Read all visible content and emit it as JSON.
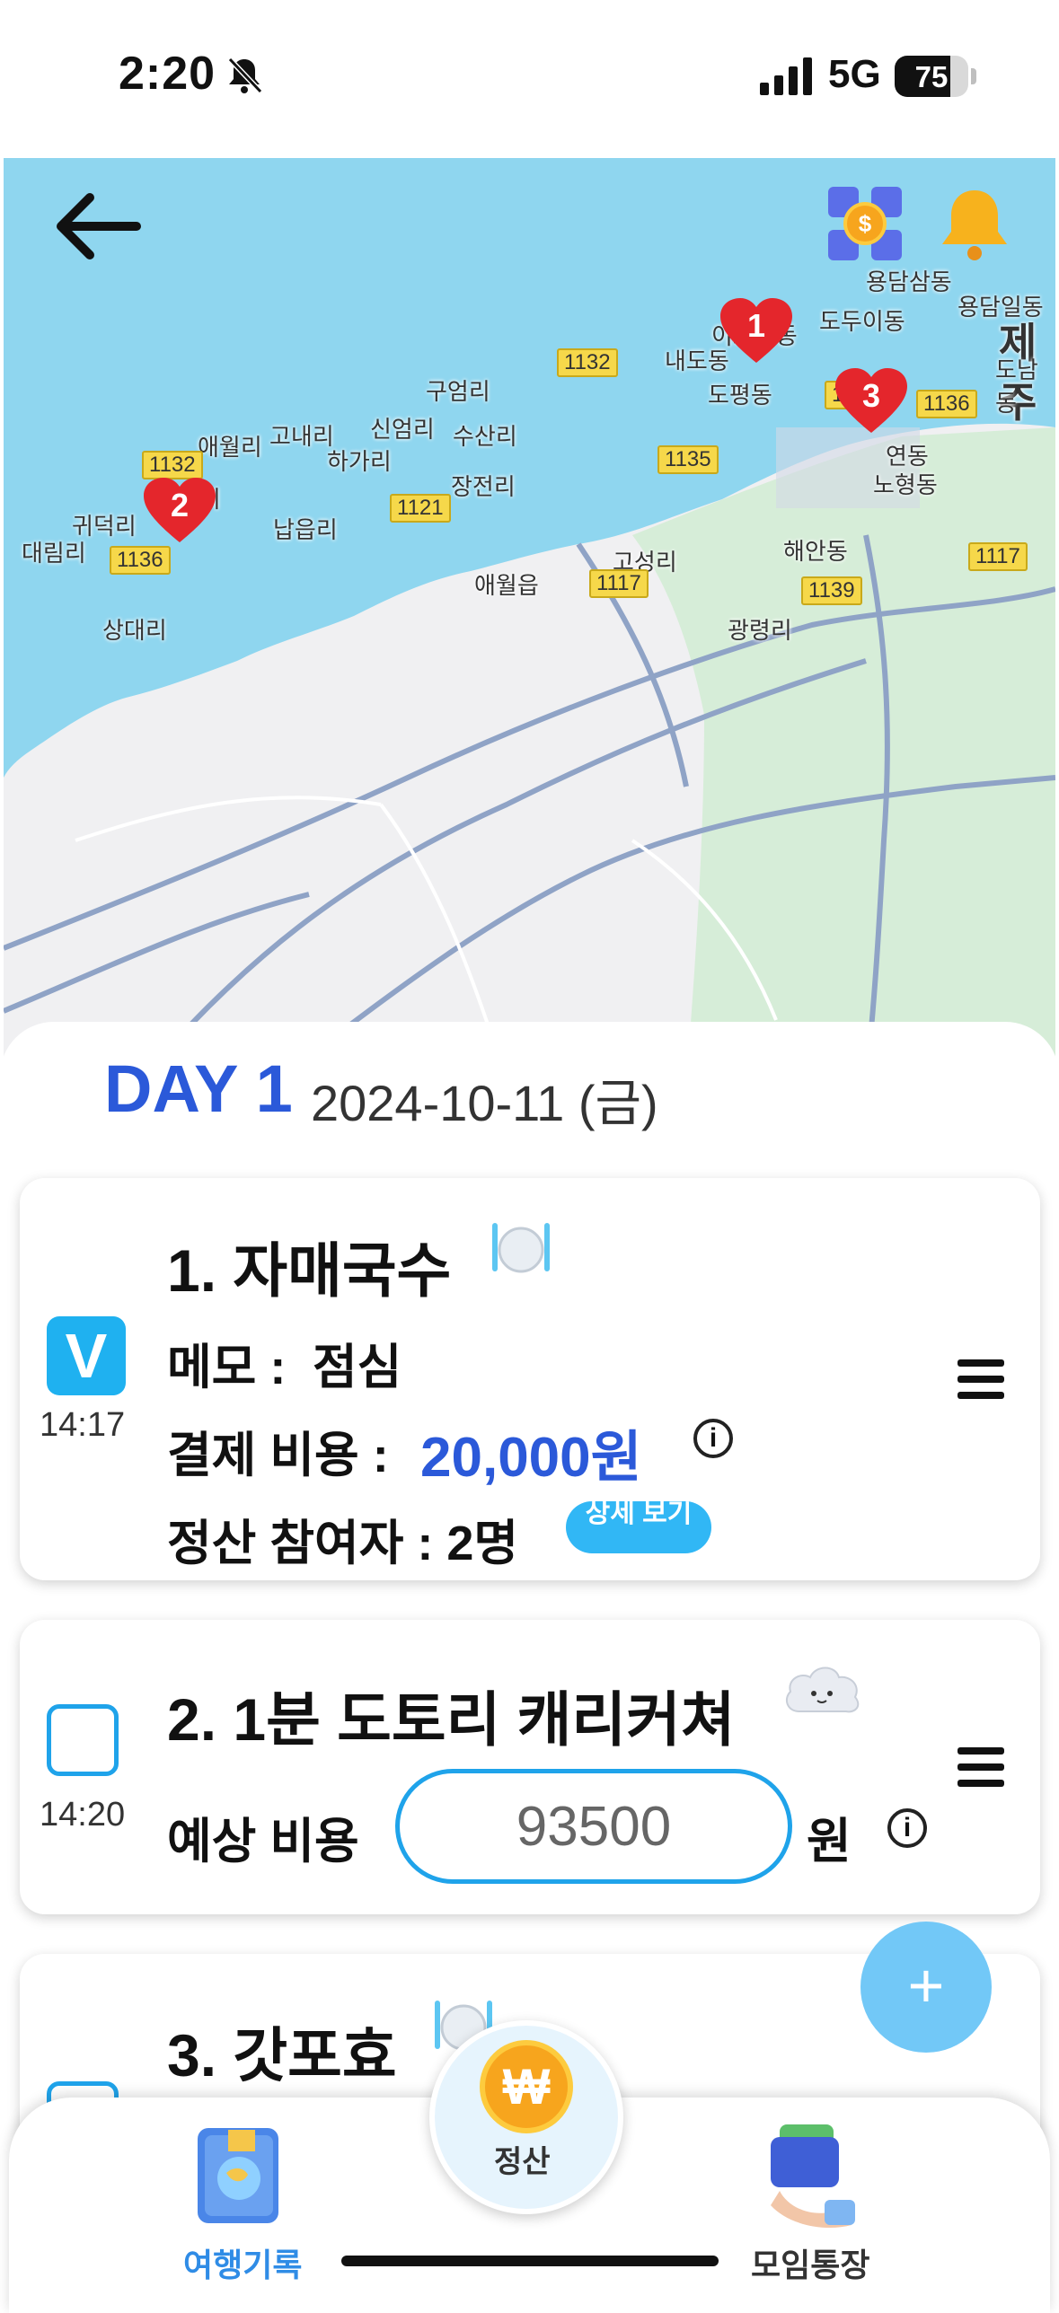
{
  "status_bar": {
    "time": "2:20",
    "network": "5G",
    "battery": "75",
    "battery_level": 0.75
  },
  "map": {
    "roads": [
      "1132",
      "1139",
      "1136",
      "1135",
      "1121",
      "1117"
    ],
    "places": [
      "용담삼동",
      "용담일동",
      "도두이동",
      "제주",
      "이호일동",
      "내도동",
      "도남동",
      "구엄리",
      "도평동",
      "연동",
      "고내리",
      "신엄리",
      "수산리",
      "애월리",
      "하가리",
      "노형동",
      "장전리",
      "곽지리",
      "귀덕리",
      "납읍리",
      "해안동",
      "대림리",
      "고성리",
      "애월읍",
      "상대리",
      "광령리"
    ],
    "pins": [
      "1",
      "2",
      "3"
    ]
  },
  "day": {
    "label": "DAY 1",
    "date": "2024-10-11 (금)"
  },
  "items": [
    {
      "title": "1. 자매국수",
      "checked": true,
      "check_mark": "V",
      "time": "14:17",
      "memo_label": "메모 :",
      "memo": "점심",
      "cost_label": "결제 비용 :",
      "cost": "20,000원",
      "participants": "정산 참여자 : 2명",
      "detail_button": "상세 보기",
      "category_icon": "plate-icon"
    },
    {
      "title": "2. 1분 도토리 캐리커쳐",
      "checked": false,
      "time": "14:20",
      "cost_label": "예상 비용",
      "cost_value": "93500",
      "unit": "원",
      "category_icon": "cloud-icon"
    },
    {
      "title": "3. 갓포효",
      "checked": false,
      "category_icon": "plate-icon"
    }
  ],
  "fab": {
    "label": "+"
  },
  "nav": {
    "left": "여행기록",
    "center": "정산",
    "center_symbol": "₩",
    "right": "모임통장"
  },
  "colors": {
    "accent": "#2b59d9",
    "checkbox": "#1fb1f0",
    "fab": "#72c8f7",
    "sea": "#8fd6ef"
  }
}
